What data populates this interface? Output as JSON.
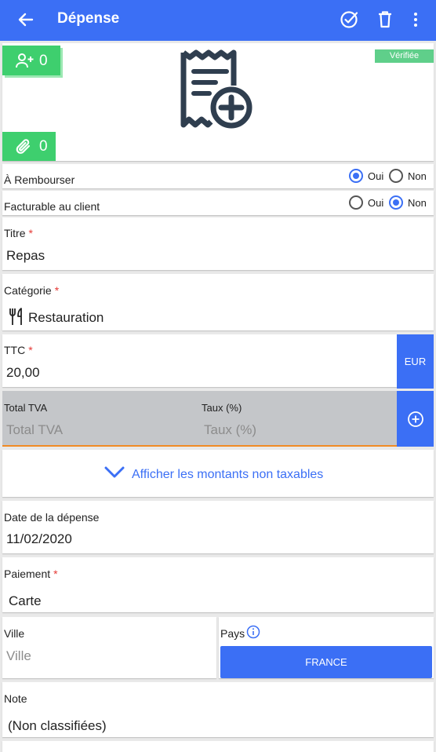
{
  "header": {
    "title": "Dépense",
    "back_icon": "arrow-left-icon",
    "actions": [
      "check-circle-icon",
      "trash-icon",
      "more-vertical-icon"
    ]
  },
  "receipt": {
    "participants_count": "0",
    "attachments_count": "0",
    "status_badge": "Vérifiée",
    "placeholder_icon": "receipt-add-icon"
  },
  "reimburse": {
    "label": "À Rembourser",
    "yes": "Oui",
    "no": "Non",
    "selected": "Oui"
  },
  "billable": {
    "label": "Facturable au client",
    "yes": "Oui",
    "no": "Non",
    "selected": "Non"
  },
  "title_field": {
    "label": "Titre",
    "required": "*",
    "value": "Repas"
  },
  "category_field": {
    "label": "Catégorie",
    "required": "*",
    "value": "Restauration",
    "icon": "fork-knife-icon"
  },
  "amount_field": {
    "label": "TTC",
    "required": "*",
    "value": "20,00",
    "currency": "EUR"
  },
  "vat": {
    "total_label": "Total TVA",
    "total_placeholder": "Total TVA",
    "rate_label": "Taux (%)",
    "rate_placeholder": "Taux (%)",
    "add_icon": "plus-circle-icon"
  },
  "non_taxable": {
    "label": "Afficher les montants non taxables",
    "icon": "chevron-down-icon"
  },
  "date_field": {
    "label": "Date de la dépense",
    "value": "11/02/2020"
  },
  "payment_field": {
    "label": "Paiement",
    "required": "*",
    "value": "Carte"
  },
  "city_field": {
    "label": "Ville",
    "placeholder": "Ville"
  },
  "country_field": {
    "label": "Pays",
    "value": "FRANCE",
    "info_icon": "info-icon"
  },
  "note_field": {
    "label": "Note",
    "value": "(Non classifiées)"
  },
  "colors": {
    "primary": "#3b6ff5",
    "chip_green": "#3ecf6e",
    "badge_green": "#5fcf8a",
    "required_red": "#e53935",
    "vat_background": "#c4c6c9",
    "vat_underline": "#f08a24"
  }
}
